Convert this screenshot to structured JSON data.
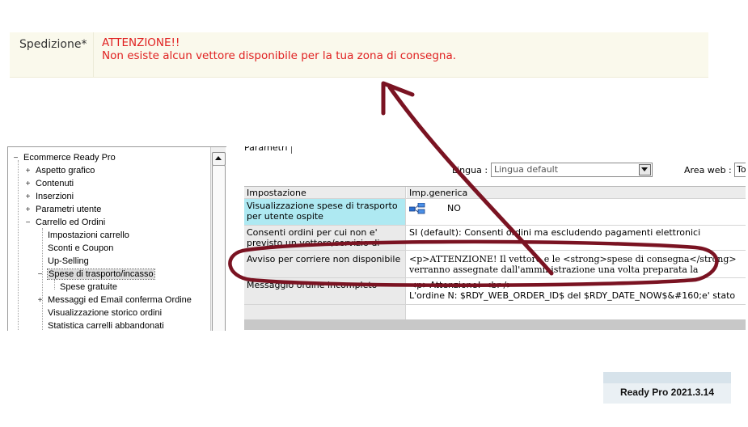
{
  "shipping": {
    "label": "Spedizione*",
    "warning_title": "ATTENZIONE!!",
    "warning_text": "Non esiste alcun vettore disponibile per la tua zona di consegna."
  },
  "tree": {
    "items": [
      {
        "label": "Ecommerce Ready Pro",
        "expander": "−"
      },
      {
        "label": "Aspetto grafico",
        "expander": "+"
      },
      {
        "label": "Contenuti",
        "expander": "+"
      },
      {
        "label": "Inserzioni",
        "expander": "+"
      },
      {
        "label": "Parametri utente",
        "expander": "+"
      },
      {
        "label": "Carrello ed Ordini",
        "expander": "−"
      },
      {
        "label": "Impostazioni carrello",
        "expander": ""
      },
      {
        "label": "Sconti e Coupon",
        "expander": ""
      },
      {
        "label": "Up-Selling",
        "expander": ""
      },
      {
        "label": "Spese di trasporto/incasso",
        "expander": "−"
      },
      {
        "label": "Spese gratuite",
        "expander": ""
      },
      {
        "label": "Messaggi ed Email conferma Ordine",
        "expander": "+"
      },
      {
        "label": "Visualizzazione storico ordini",
        "expander": ""
      },
      {
        "label": "Statistica carrelli abbandonati",
        "expander": ""
      }
    ]
  },
  "params": {
    "tab_label": "Parametri",
    "lingua_label": "Lingua :",
    "lingua_value": "Lingua default",
    "area_label": "Area web :",
    "area_value": "To",
    "header": {
      "col1": "Impostazione",
      "col2": "Imp.generica"
    },
    "rows": [
      {
        "setting": "Visualizzazione spese di trasporto per utente ospite",
        "value": "NO"
      },
      {
        "setting": "Consenti ordini per cui non e' previsto un vettore/servizio di consegna",
        "value": "SI (default): Consenti ordini ma escludendo pagamenti  elettronici"
      },
      {
        "setting": "Avviso per corriere non disponibile",
        "value_line1": "<p>ATTENZIONE! Il vettore e le <strong>spese di consegna</strong>",
        "value_line2": "verranno assegnate dall'amministrazione una volta preparata la"
      },
      {
        "setting": "Messaggio ordine incompleto",
        "value_line1": "<p>Attenzione! <br />",
        "value_line2": "L'ordine N: $RDY_WEB_ORDER_ID$ del $RDY_DATE_NOW$&#160;e' stato"
      }
    ]
  },
  "annotation_color": "#7a1322",
  "version": "Ready Pro 2021.3.14"
}
